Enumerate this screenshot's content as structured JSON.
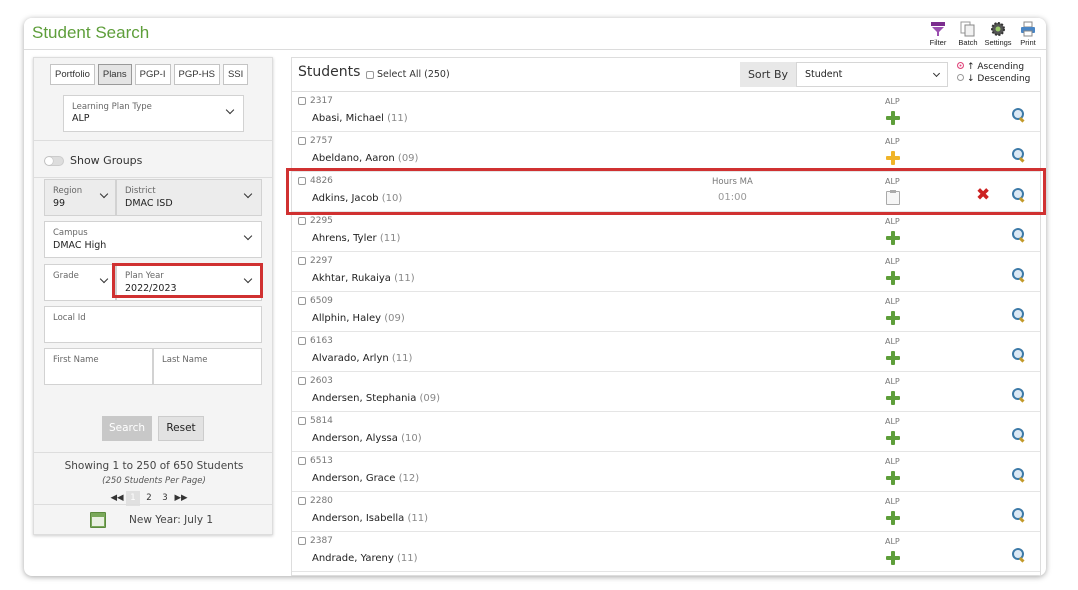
{
  "app": {
    "title": "Student Search"
  },
  "toolbar": [
    {
      "label": "Filter",
      "icon": "filter-icon"
    },
    {
      "label": "Batch",
      "icon": "batch-icon"
    },
    {
      "label": "Settings",
      "icon": "gear-icon"
    },
    {
      "label": "Print",
      "icon": "printer-icon"
    }
  ],
  "left": {
    "tabs": [
      "Portfolio",
      "Plans",
      "PGP-I",
      "PGP-HS",
      "SSI"
    ],
    "active_tab": "Plans",
    "plan_type": {
      "label": "Learning Plan Type",
      "value": "ALP"
    },
    "show_groups": "Show Groups",
    "region": {
      "label": "Region",
      "value": "99"
    },
    "district": {
      "label": "District",
      "value": "DMAC ISD"
    },
    "campus": {
      "label": "Campus",
      "value": "DMAC High"
    },
    "grade": {
      "label": "Grade",
      "value": ""
    },
    "plan_year": {
      "label": "Plan Year",
      "value": "2022/2023"
    },
    "local_id": {
      "label": "Local Id",
      "value": ""
    },
    "first_name": {
      "label": "First Name",
      "value": ""
    },
    "last_name": {
      "label": "Last Name",
      "value": ""
    },
    "search_btn": "Search",
    "reset_btn": "Reset",
    "showing": "Showing 1 to 250 of 650 Students",
    "per_page": "(250 Students Per Page)",
    "pager": {
      "first": "◀◀",
      "p1": "1",
      "p2": "2",
      "p3": "3",
      "last": "▶▶"
    },
    "new_year": "New Year: July 1"
  },
  "main": {
    "title": "Students",
    "select_all": "Select All (250)",
    "sort_by_label": "Sort By",
    "sort_value": "Student",
    "ascending": "↑ Ascending",
    "descending": "↓ Descending",
    "hours_label": "Hours MA",
    "hours_value": "01:00",
    "students": [
      {
        "id": "2317",
        "name": "Abasi, Michael",
        "grade": "(11)",
        "plan": "ALP",
        "status": "add"
      },
      {
        "id": "2757",
        "name": "Abeldano, Aaron",
        "grade": "(09)",
        "plan": "ALP",
        "status": "add-pending"
      },
      {
        "id": "4826",
        "name": "Adkins, Jacob",
        "grade": "(10)",
        "plan": "ALP",
        "status": "existing"
      },
      {
        "id": "2295",
        "name": "Ahrens, Tyler",
        "grade": "(11)",
        "plan": "ALP",
        "status": "add"
      },
      {
        "id": "2297",
        "name": "Akhtar, Rukaiya",
        "grade": "(11)",
        "plan": "ALP",
        "status": "add"
      },
      {
        "id": "6509",
        "name": "Allphin, Haley",
        "grade": "(09)",
        "plan": "ALP",
        "status": "add"
      },
      {
        "id": "6163",
        "name": "Alvarado, Arlyn",
        "grade": "(11)",
        "plan": "ALP",
        "status": "add"
      },
      {
        "id": "2603",
        "name": "Andersen, Stephania",
        "grade": "(09)",
        "plan": "ALP",
        "status": "add"
      },
      {
        "id": "5814",
        "name": "Anderson, Alyssa",
        "grade": "(10)",
        "plan": "ALP",
        "status": "add"
      },
      {
        "id": "6513",
        "name": "Anderson, Grace",
        "grade": "(12)",
        "plan": "ALP",
        "status": "add"
      },
      {
        "id": "2280",
        "name": "Anderson, Isabella",
        "grade": "(11)",
        "plan": "ALP",
        "status": "add"
      },
      {
        "id": "2387",
        "name": "Andrade, Yareny",
        "grade": "(11)",
        "plan": "ALP",
        "status": "add"
      }
    ]
  }
}
